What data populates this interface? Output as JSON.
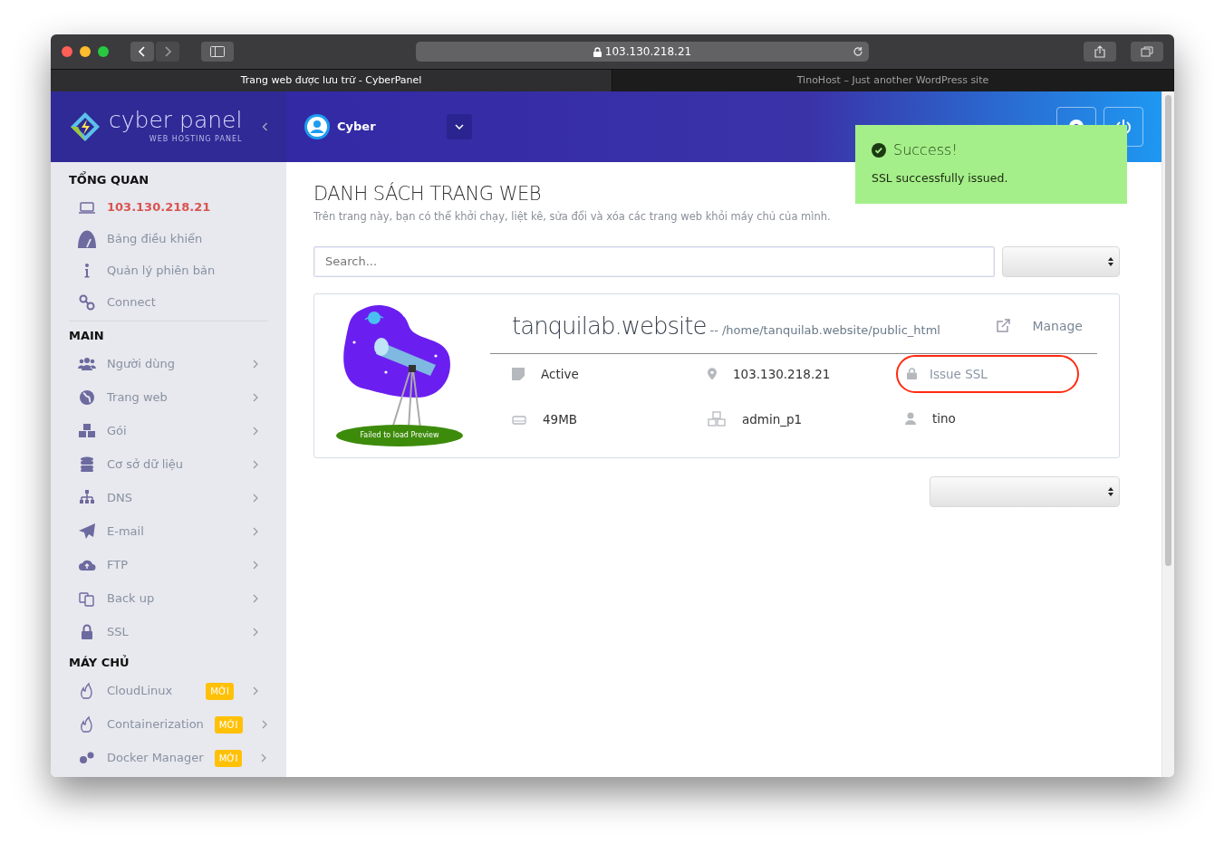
{
  "browser": {
    "url": "103.130.218.21",
    "tabs": [
      {
        "title": "Trang web được lưu trữ - CyberPanel",
        "selected": true
      },
      {
        "title": "TinoHost – Just another WordPress site",
        "selected": false
      }
    ]
  },
  "header": {
    "logo_text": "cyber panel",
    "logo_subtitle": "WEB HOSTING PANEL",
    "user": "Cyber"
  },
  "toast": {
    "title": "Success!",
    "message": "SSL successfully issued."
  },
  "sidebar": {
    "sections": [
      {
        "heading": "TỔNG QUAN",
        "items": [
          {
            "label": "103.130.218.21",
            "selected": true,
            "submenu": false
          },
          {
            "label": "Bảng điều khiển",
            "selected": false,
            "submenu": false
          },
          {
            "label": "Quản lý phiên bản",
            "selected": false,
            "submenu": false
          },
          {
            "label": "Connect",
            "selected": false,
            "submenu": false
          }
        ]
      },
      {
        "heading": "MAIN",
        "items": [
          {
            "label": "Người dùng",
            "selected": false,
            "submenu": true
          },
          {
            "label": "Trang web",
            "selected": false,
            "submenu": true
          },
          {
            "label": "Gói",
            "selected": false,
            "submenu": true
          },
          {
            "label": "Cơ sở dữ liệu",
            "selected": false,
            "submenu": true
          },
          {
            "label": "DNS",
            "selected": false,
            "submenu": true
          },
          {
            "label": "E-mail",
            "selected": false,
            "submenu": true
          },
          {
            "label": "FTP",
            "selected": false,
            "submenu": true
          },
          {
            "label": "Back up",
            "selected": false,
            "submenu": true
          },
          {
            "label": "SSL",
            "selected": false,
            "submenu": true
          }
        ]
      },
      {
        "heading": "MÁY CHỦ",
        "items": [
          {
            "label": "CloudLinux",
            "selected": false,
            "submenu": true,
            "badge": "MỚI"
          },
          {
            "label": "Containerization",
            "selected": false,
            "submenu": true,
            "badge": "MỚI"
          },
          {
            "label": "Docker Manager",
            "selected": false,
            "submenu": true,
            "badge": "MỚI"
          }
        ]
      }
    ]
  },
  "page": {
    "title": "DANH SÁCH TRANG WEB",
    "subtitle": "Trên trang này, bạn có thể khởi chạy, liệt kê, sửa đổi và xóa các trang web khỏi máy chủ của mình.",
    "search": {
      "placeholder": "Search..."
    },
    "website": {
      "preview_caption": "Failed to load Preview",
      "domain": "tanquilab.website",
      "path": "-- /home/tanquilab.website/public_html",
      "manage": "Manage",
      "status": "Active",
      "ip": "103.130.218.21",
      "ssl": "Issue SSL",
      "disk": "49MB",
      "package": "admin_p1",
      "owner": "tino"
    }
  }
}
